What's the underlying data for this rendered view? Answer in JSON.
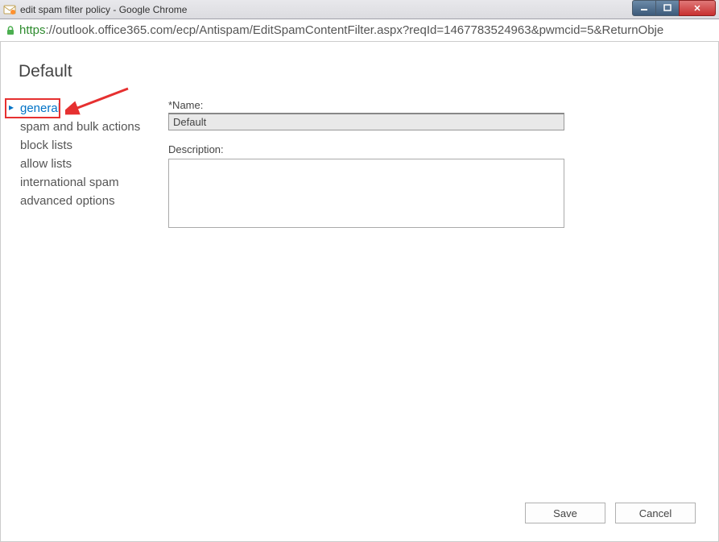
{
  "window": {
    "title": "edit spam filter policy - Google Chrome"
  },
  "url": {
    "scheme": "https",
    "rest": "://outlook.office365.com/ecp/Antispam/EditSpamContentFilter.aspx?reqId=1467783524963&pwmcid=5&ReturnObje"
  },
  "page": {
    "title": "Default"
  },
  "sidebar": {
    "items": [
      {
        "label": "general",
        "active": true
      },
      {
        "label": "spam and bulk actions",
        "active": false
      },
      {
        "label": "block lists",
        "active": false
      },
      {
        "label": "allow lists",
        "active": false
      },
      {
        "label": "international spam",
        "active": false
      },
      {
        "label": "advanced options",
        "active": false
      }
    ]
  },
  "form": {
    "name_label": "*Name:",
    "name_value": "Default",
    "description_label": "Description:",
    "description_value": ""
  },
  "buttons": {
    "save": "Save",
    "cancel": "Cancel"
  },
  "annotation": {
    "highlight_target": "general"
  }
}
